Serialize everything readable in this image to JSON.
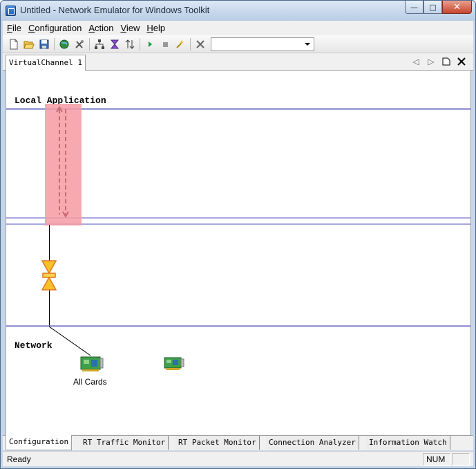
{
  "window": {
    "title": "Untitled - Network Emulator for Windows Toolkit",
    "minimize": "—",
    "maximize": "□",
    "close": "✕"
  },
  "menu": [
    {
      "label": "File",
      "accel": "F",
      "rest": "ile"
    },
    {
      "label": "Configuration",
      "accel": "C",
      "rest": "onfiguration"
    },
    {
      "label": "Action",
      "accel": "A",
      "rest": "ction"
    },
    {
      "label": "View",
      "accel": "V",
      "rest": "iew"
    },
    {
      "label": "Help",
      "accel": "H",
      "rest": "elp"
    }
  ],
  "toolbar": {
    "icons": [
      "new-file-icon",
      "open-folder-icon",
      "save-icon",
      "globe-icon",
      "tools-icon",
      "network-tree-icon",
      "hourglass-filter-icon",
      "sort-arrows-icon",
      "play-icon",
      "stop-icon",
      "wizard-icon",
      "delete-x-icon"
    ],
    "combo_value": ""
  },
  "document_tab": {
    "label": "VirtualChannel 1",
    "prev": "◁",
    "next": "▷"
  },
  "canvas": {
    "local_label": "Local Application",
    "network_label": "Network",
    "card_label": "All Cards",
    "highlight_color": "#f49aa2",
    "lane_color": "#a7a7dd",
    "filter_color": "#f7c12b"
  },
  "bottom_tabs": [
    "Configuration",
    "RT Traffic Monitor",
    "RT Packet Monitor",
    "Connection Analyzer",
    "Information Watch"
  ],
  "status": {
    "text": "Ready",
    "num": "NUM"
  }
}
